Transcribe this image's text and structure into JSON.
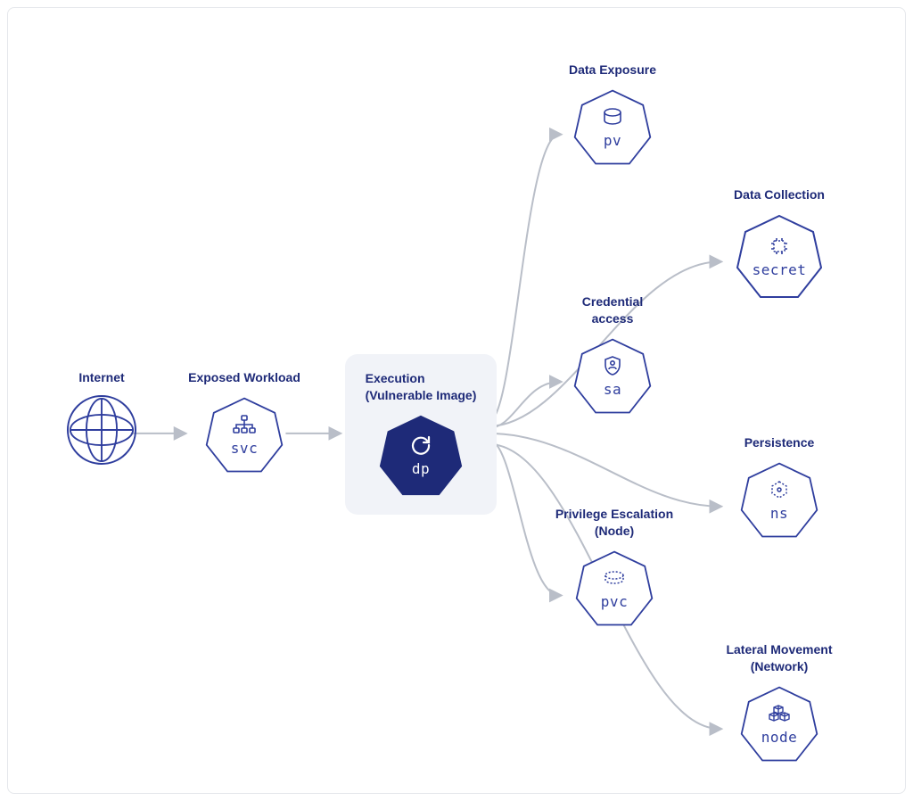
{
  "diagram": {
    "colors": {
      "primary": "#1e2a78",
      "iconStroke": "#2f3e9e",
      "arrow": "#b9bec8",
      "boxBg": "#f1f3f8"
    },
    "nodes": {
      "internet": {
        "label": "Internet"
      },
      "exposed": {
        "label": "Exposed Workload",
        "short": "svc"
      },
      "execution": {
        "label": "Execution\n(Vulnerable Image)",
        "short": "dp"
      },
      "data_exposure": {
        "label": "Data Exposure",
        "short": "pv"
      },
      "data_collection": {
        "label": "Data Collection",
        "short": "secret"
      },
      "credential_access": {
        "label": "Credential\naccess",
        "short": "sa"
      },
      "persistence": {
        "label": "Persistence",
        "short": "ns"
      },
      "priv_esc": {
        "label": "Privilege Escalation\n(Node)",
        "short": "pvc"
      },
      "lateral": {
        "label": "Lateral Movement\n(Network)",
        "short": "node"
      }
    }
  }
}
